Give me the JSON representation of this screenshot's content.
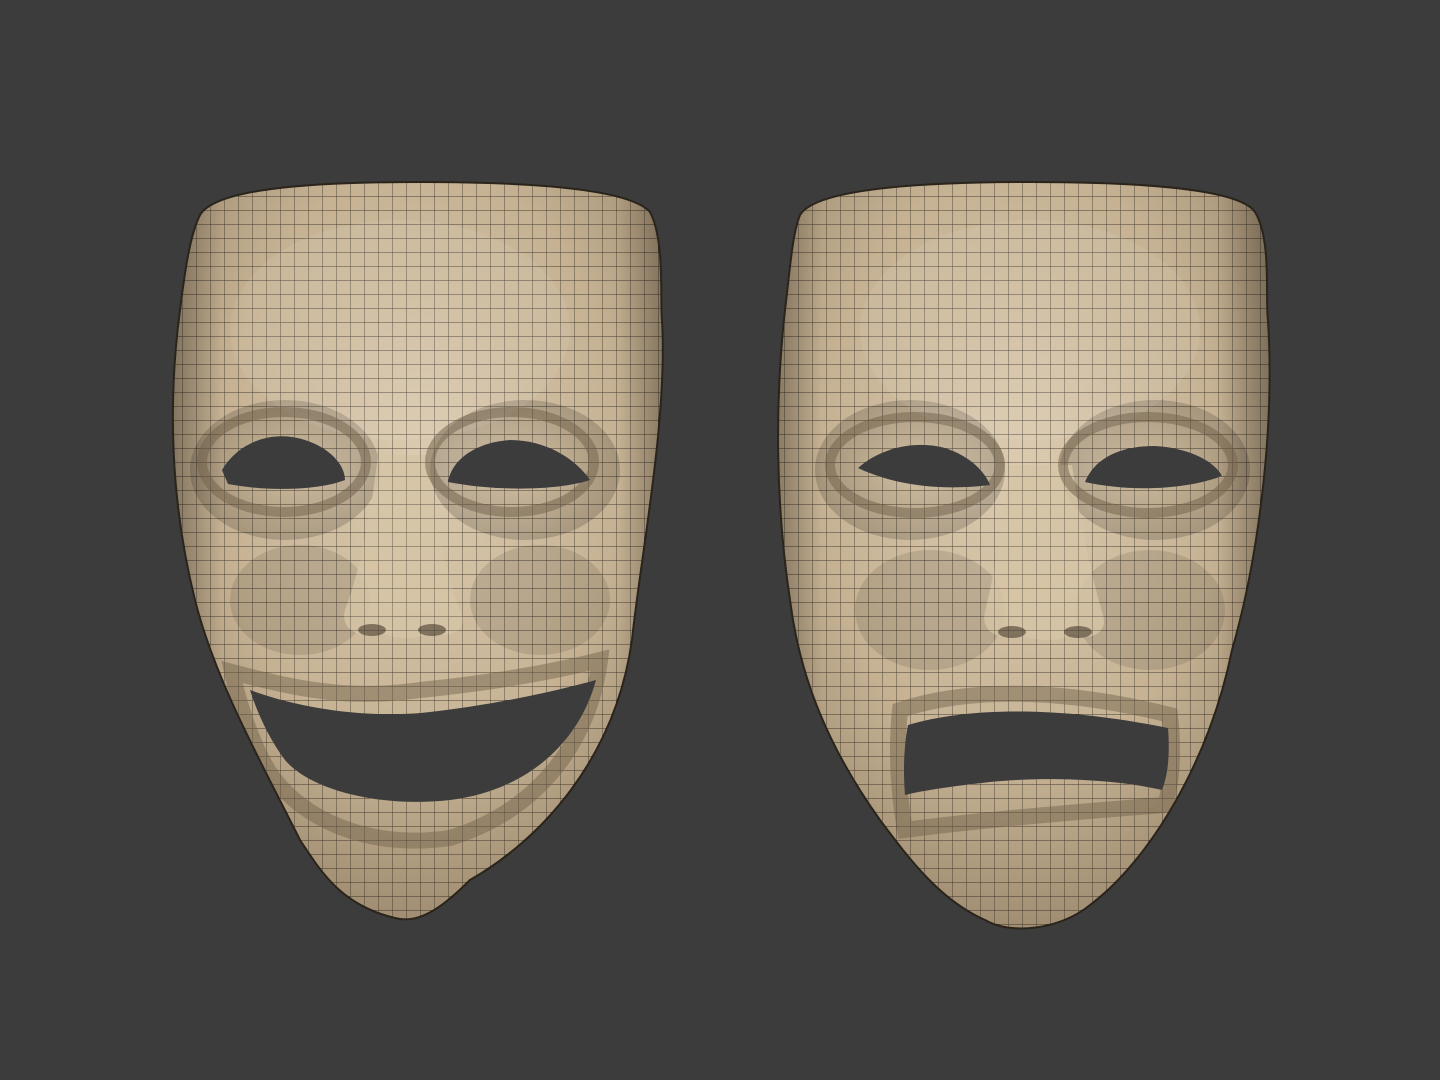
{
  "scene": {
    "background_color": "#3c3c3c",
    "material_color": "#c7b394",
    "material_highlight": "#dcccb1",
    "material_shadow": "#8f7c63",
    "wire_color": "#1e1a14"
  },
  "masks": [
    {
      "name": "comedy-mask",
      "expression": "smiling"
    },
    {
      "name": "tragedy-mask",
      "expression": "sad"
    }
  ]
}
